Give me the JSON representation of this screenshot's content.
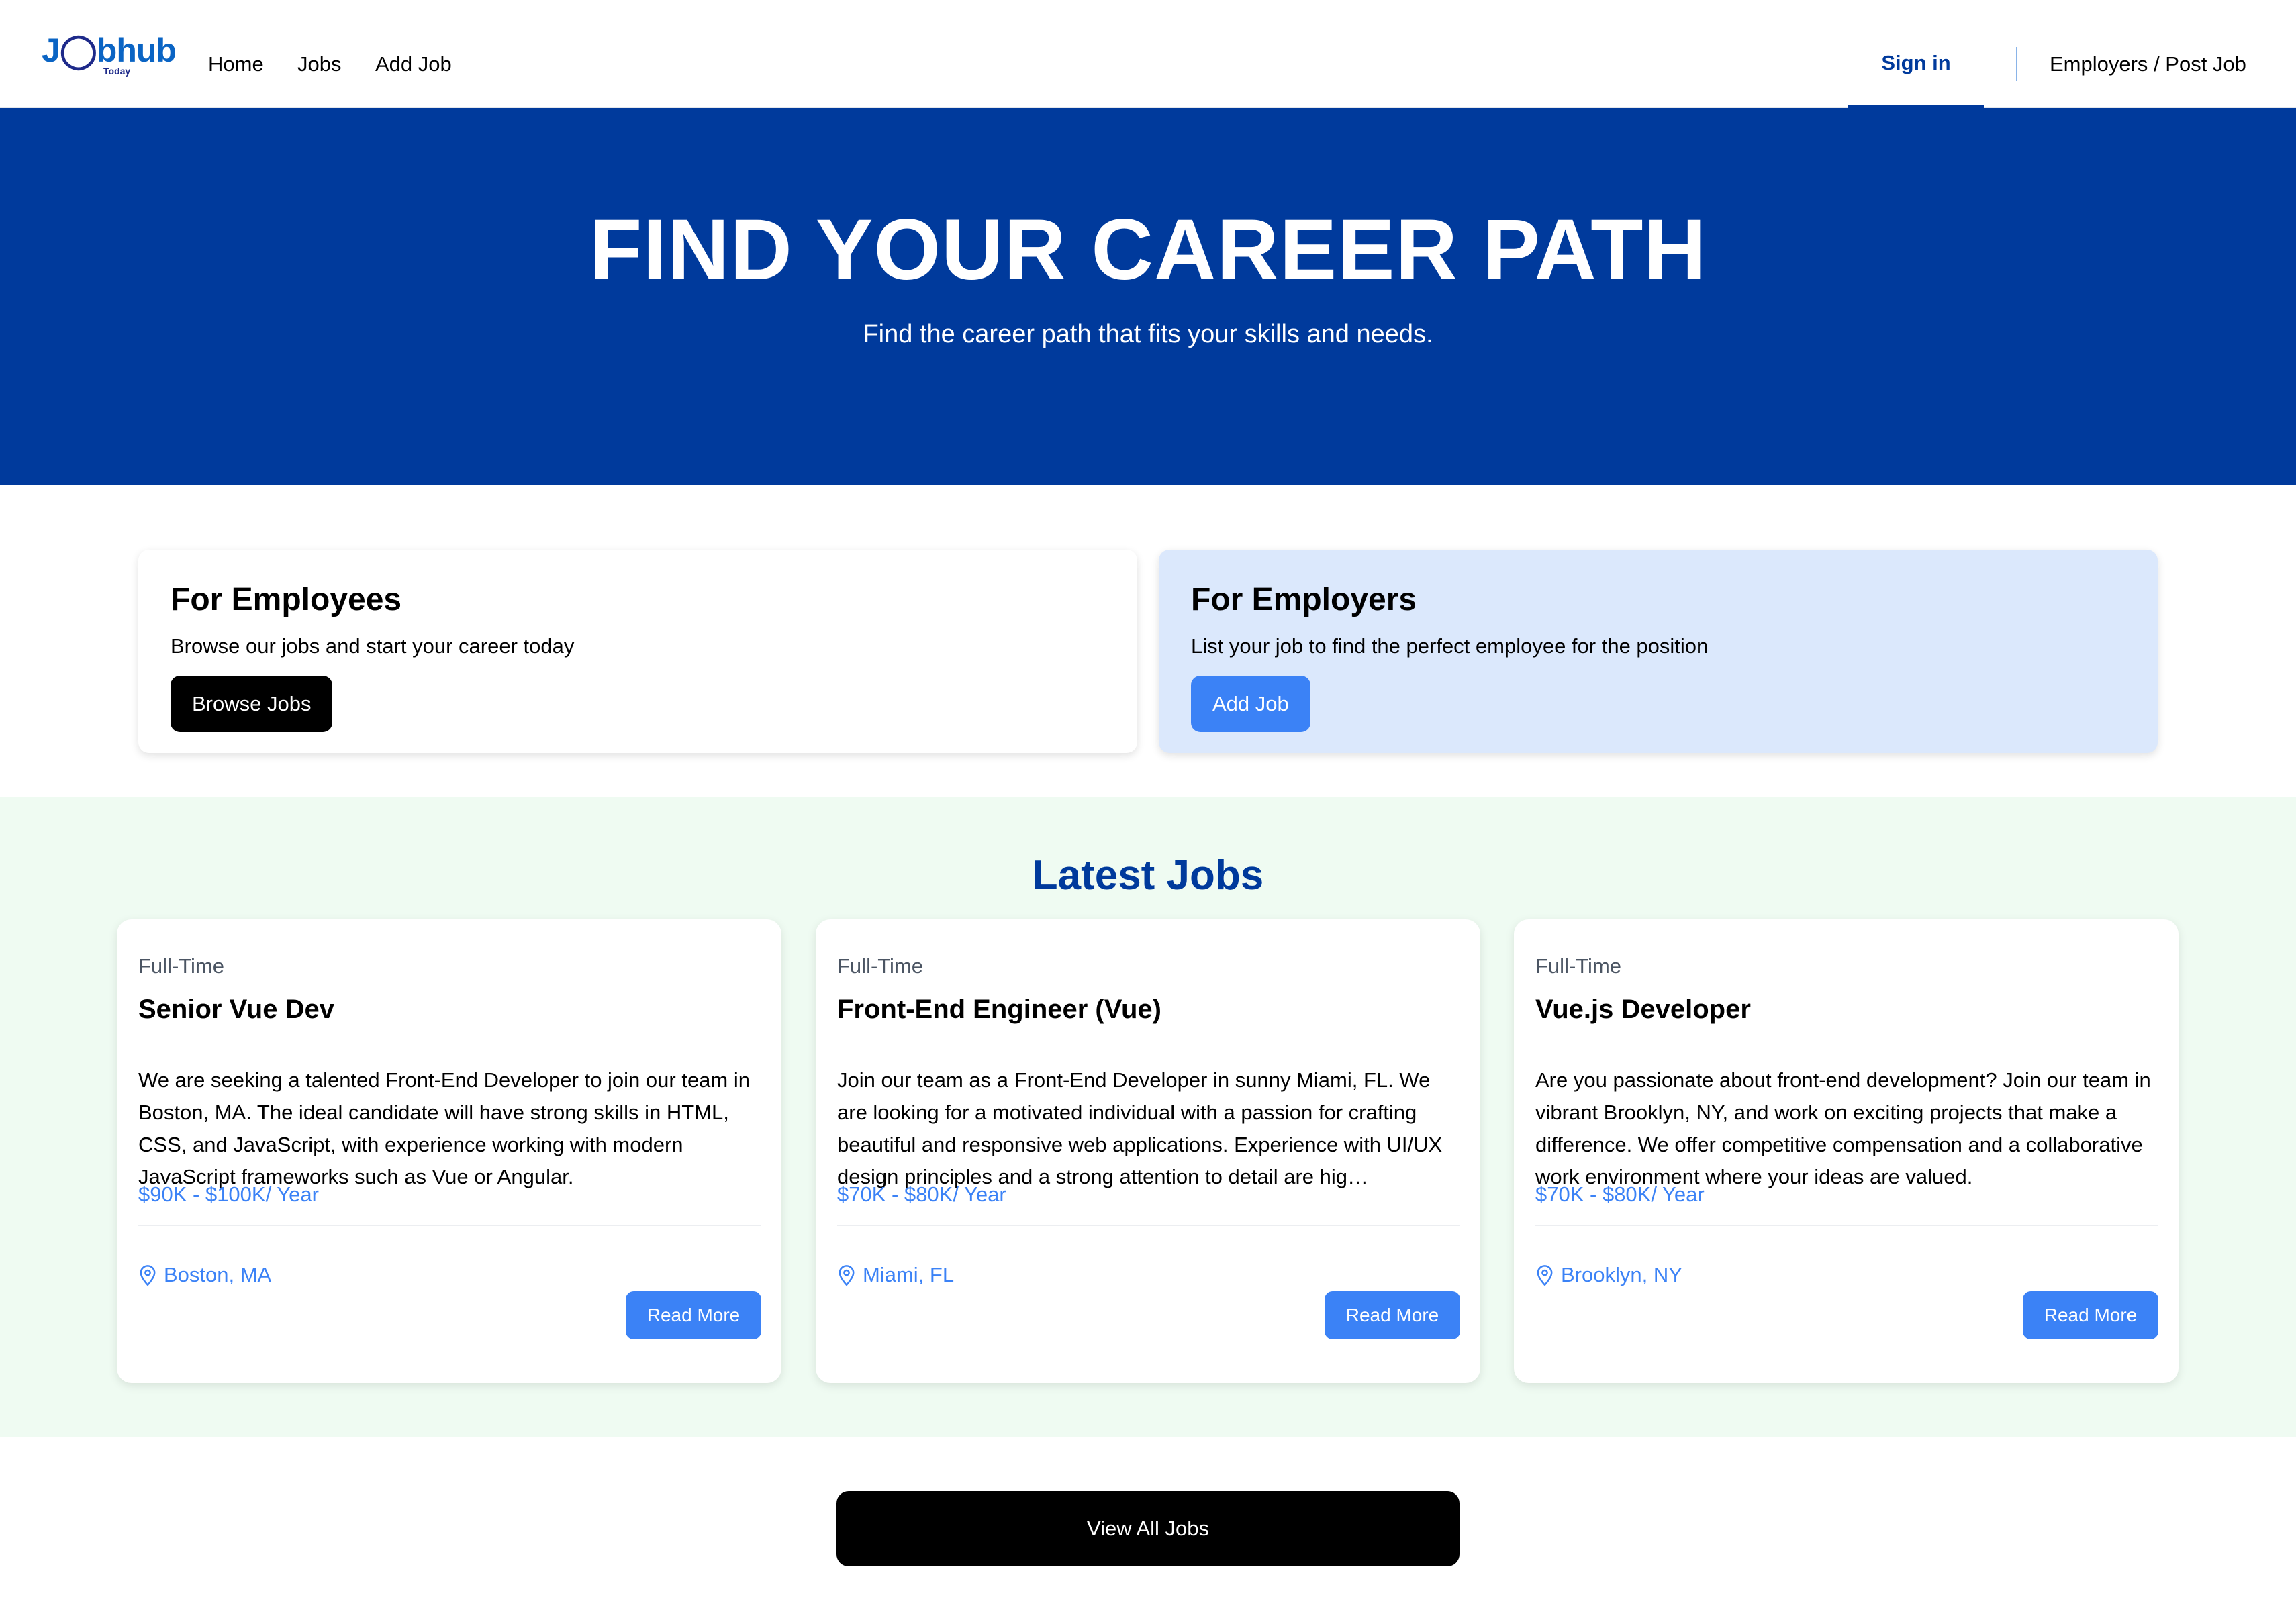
{
  "nav": {
    "logo_text_a": "J",
    "logo_text_b": "bhub",
    "logo_sub": "Today",
    "links": [
      "Home",
      "Jobs",
      "Add Job"
    ],
    "sign_in": "Sign in",
    "employers": "Employers / Post Job"
  },
  "hero": {
    "title": "FIND YOUR CAREER PATH",
    "subtitle": "Find the career path that fits your skills and needs."
  },
  "info_cards": {
    "employees": {
      "title": "For Employees",
      "text": "Browse our jobs and start your career today",
      "button": "Browse Jobs"
    },
    "employers": {
      "title": "For Employers",
      "text": "List your job to find the perfect employee for the position",
      "button": "Add Job"
    }
  },
  "latest": {
    "title": "Latest Jobs",
    "jobs": [
      {
        "type": "Full-Time",
        "title": "Senior Vue Dev",
        "description": "We are seeking a talented Front-End Developer to join our team in Boston, MA. The ideal candidate will have strong skills in HTML, CSS, and JavaScript, with experience working with modern JavaScript frameworks such as Vue or Angular.",
        "salary": "$90K - $100K/ Year",
        "location": "Boston, MA",
        "button": "Read More"
      },
      {
        "type": "Full-Time",
        "title": "Front-End Engineer (Vue)",
        "description": "Join our team as a Front-End Developer in sunny Miami, FL. We are looking for a motivated individual with a passion for crafting beautiful and responsive web applications. Experience with UI/UX design principles and a strong attention to detail are hig…",
        "salary": "$70K - $80K/ Year",
        "location": "Miami, FL",
        "button": "Read More"
      },
      {
        "type": "Full-Time",
        "title": "Vue.js Developer",
        "description": "Are you passionate about front-end development? Join our team in vibrant Brooklyn, NY, and work on exciting projects that make a difference. We offer competitive compensation and a collaborative work environment where your ideas are valued.",
        "salary": "$70K - $80K/ Year",
        "location": "Brooklyn, NY",
        "button": "Read More"
      }
    ]
  },
  "view_all": "View All Jobs",
  "colors": {
    "primary": "#003a9c",
    "accent": "#3b82f6",
    "employer_card_bg": "#dbe8fc",
    "latest_bg": "#effbf2"
  }
}
